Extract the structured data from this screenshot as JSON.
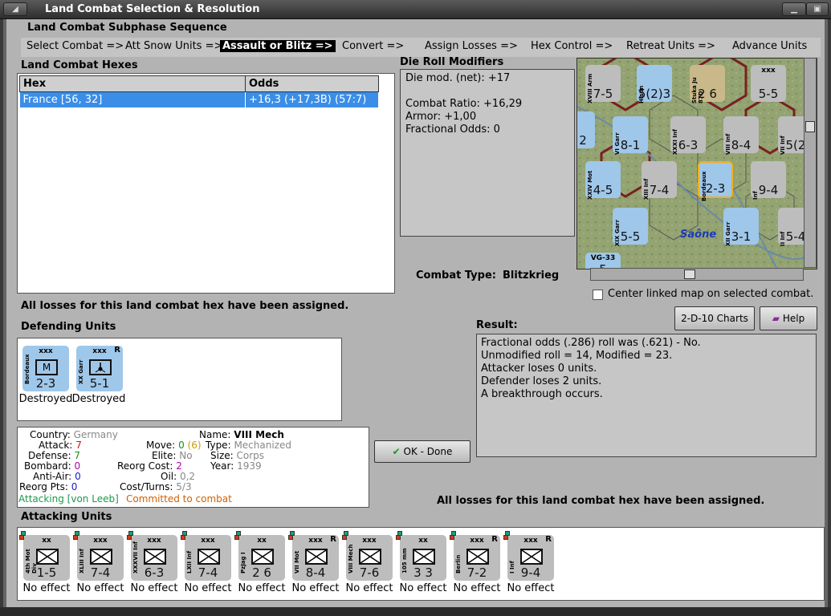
{
  "window": {
    "title": "Land Combat Selection & Resolution"
  },
  "subphase": {
    "title": "Land Combat Subphase Sequence",
    "steps": [
      "Select Combat =>",
      "Att Snow Units =>",
      "Assault or Blitz =>",
      "Convert =>",
      "Assign Losses =>",
      "Hex Control =>",
      "Retreat Units =>",
      "Advance Units"
    ],
    "selected_index": 2
  },
  "hexes": {
    "title": "Land Combat Hexes",
    "columns": [
      "Hex",
      "Odds"
    ],
    "rows": [
      {
        "hex": "France [56, 32]",
        "odds": "+16,3 (+17,3B) (57:7)"
      }
    ]
  },
  "modifiers": {
    "title": "Die Roll Modifiers",
    "lines": [
      "Die mod. (net): +17",
      "",
      "Combat Ratio: +16,29",
      "Armor: +1,00",
      "Fractional Odds: 0"
    ]
  },
  "combat_type": {
    "label": "Combat Type:",
    "value": "Blitzkrieg"
  },
  "center_map": {
    "label": "Center linked map on selected combat.",
    "checked": false
  },
  "buttons": {
    "charts": "2-D-10 Charts",
    "help": "Help",
    "ok": "OK - Done"
  },
  "losses_msg": "All losses for this land combat hex have been assigned.",
  "defending": {
    "title": "Defending Units",
    "units": [
      {
        "size": "xxx",
        "name": "Bordeaux",
        "value": "2-3",
        "status": "Destroyed",
        "symbol": "M",
        "reserve": ""
      },
      {
        "size": "xxx",
        "name": "XX Garr",
        "value": "5-1",
        "status": "Destroyed",
        "symbol": "garr",
        "reserve": "R"
      }
    ]
  },
  "result": {
    "title": "Result:",
    "lines": [
      "Fractional odds (.286) roll was (.621)  - No.",
      "Unmodified roll = 14, Modified = 23.",
      "Attacker loses 0 units.",
      "Defender loses 2 units.",
      "A breakthrough occurs."
    ]
  },
  "unit_info": {
    "country_label": "Country:",
    "country": "Germany",
    "attack_label": "Attack:",
    "attack": "7",
    "defense_label": "Defense:",
    "defense": "7",
    "bombard_label": "Bombard:",
    "bombard": "0",
    "antiair_label": "Anti-Air:",
    "antiair": "0",
    "reorg_pts_label": "Reorg Pts:",
    "reorg_pts": "0",
    "name_label": "Name:",
    "name": "VIII Mech",
    "move_label": "Move:",
    "move": "0",
    "move_extra": "(6)",
    "type_label": "Type:",
    "type": "Mechanized",
    "elite_label": "Elite:",
    "elite": "No",
    "size_label": "Size:",
    "size": "Corps",
    "reorg_cost_label": "Reorg Cost:",
    "reorg_cost": "2",
    "year_label": "Year:",
    "year": "1939",
    "oil_label": "Oil:",
    "oil": "0,2",
    "cost_label": "Cost/Turns:",
    "cost": "5/3",
    "attacking_text": "Attacking [von Leeb]",
    "committed_text": "Committed to combat"
  },
  "attacking": {
    "title": "Attacking Units",
    "units": [
      {
        "size": "xx",
        "name": "4th Mot Div",
        "value": "1-5",
        "status": "No effect",
        "reserve": ""
      },
      {
        "size": "xxx",
        "name": "XLIII Inf",
        "value": "7-4",
        "status": "No effect",
        "reserve": ""
      },
      {
        "size": "xxx",
        "name": "XXXVII Inf",
        "value": "6-3",
        "status": "No effect",
        "reserve": ""
      },
      {
        "size": "xxx",
        "name": "LXII Inf",
        "value": "7-4",
        "status": "No effect",
        "reserve": ""
      },
      {
        "size": "xx",
        "name": "PzJag I",
        "value": "2 6",
        "status": "No effect",
        "reserve": ""
      },
      {
        "size": "xxx",
        "name": "VII Mot",
        "value": "8-4",
        "status": "No effect",
        "reserve": "R"
      },
      {
        "size": "xxx",
        "name": "VIII Mech",
        "value": "7-6",
        "status": "No effect",
        "reserve": ""
      },
      {
        "size": "xx",
        "name": "105 mm",
        "value": "3 3",
        "status": "No effect",
        "reserve": ""
      },
      {
        "size": "xxx",
        "name": "Berlin",
        "value": "7-2",
        "status": "No effect",
        "reserve": "R"
      },
      {
        "size": "xxx",
        "name": "I Inf",
        "value": "9-4",
        "status": "No effect",
        "reserve": "R"
      }
    ]
  },
  "map": {
    "place_label": "Saône",
    "counters": [
      {
        "name": "XVIII Arm",
        "value": "7-5"
      },
      {
        "name": "Hlsdn",
        "value": "5(2)3"
      },
      {
        "name": "Stuka Ju 87D",
        "value": "2 6"
      },
      {
        "name": "xxx",
        "value": "5-5"
      },
      {
        "name": "xxx",
        "value": "2"
      },
      {
        "name": "VI Garr",
        "value": "8-1"
      },
      {
        "name": "XXXI Inf",
        "value": "6-3"
      },
      {
        "name": "VIII Inf",
        "value": "8-4"
      },
      {
        "name": "VII Inf",
        "value": "5(2"
      },
      {
        "name": "XXIV Mot",
        "value": "4-5"
      },
      {
        "name": "XIII Inf",
        "value": "7-4"
      },
      {
        "name": "Bordeaux",
        "value": "2-3"
      },
      {
        "name": "Inf",
        "value": "9-4"
      },
      {
        "name": "XIX Garr",
        "value": "5-5"
      },
      {
        "name": "XII Garr",
        "value": "3-1"
      },
      {
        "name": "II Inf",
        "value": "5-4"
      },
      {
        "name": "VG-33",
        "value": "5"
      }
    ]
  },
  "colors": {
    "selected_row": "#3a8ee8",
    "french_unit": "#9fc7ea",
    "german_unit": "#bdbdbd",
    "attack": "#c81414",
    "defense": "#1a8a1a",
    "bombard": "#b000b0",
    "antiair": "#1a1ac8",
    "reorg_cost": "#b000b0",
    "attacking_text": "#1a9a4a",
    "committed_text": "#d06000"
  }
}
